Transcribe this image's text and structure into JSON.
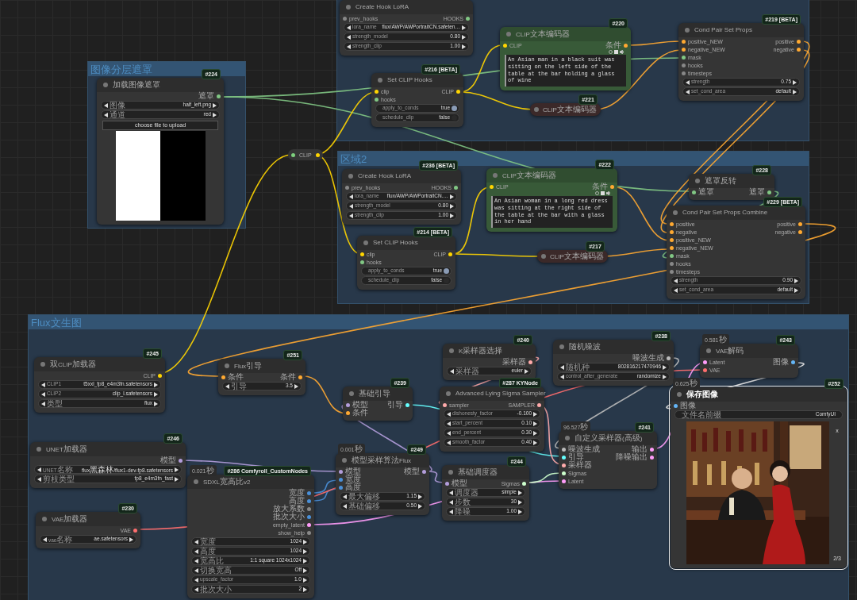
{
  "groups": [
    {
      "kind": "titled",
      "title": "图像分层遮罩"
    },
    {
      "kind": "frame"
    },
    {
      "kind": "titled",
      "title": "区域2"
    },
    {
      "kind": "titled",
      "title": "Flux文生图"
    }
  ],
  "nodes": [
    {
      "kind": "node",
      "badge": "#224",
      "title": "加载图像遮罩",
      "color": "#353535",
      "selected": false,
      "outputs": [
        {
          "label": "遮罩",
          "color": "#81c784"
        }
      ],
      "widgets": [
        {
          "kind": "combo",
          "label": "图像",
          "value": "half_left.png"
        },
        {
          "kind": "combo",
          "label": "通道",
          "value": "red"
        },
        {
          "kind": "button",
          "label": "choose file to upload"
        },
        {
          "kind": "mask"
        }
      ]
    },
    {
      "kind": "node",
      "title": "Create Hook LoRA",
      "color": "#353535",
      "selected": false,
      "inputs": [
        {
          "label": "prev_hooks",
          "color": "#888888"
        }
      ],
      "outputs": [
        {
          "label": "HOOKS",
          "color": "#81c784"
        }
      ],
      "widgets": [
        {
          "kind": "combo",
          "label": "lora_name",
          "value": "flux/AWP/AWPortraitCN.safeten…"
        },
        {
          "kind": "combo",
          "label": "strength_model",
          "value": "0.80"
        },
        {
          "kind": "combo",
          "label": "strength_clip",
          "value": "1.00"
        }
      ]
    },
    {
      "kind": "node",
      "badge": "#216 [BETA]",
      "title": "Set CLIP Hooks",
      "color": "#353535",
      "selected": false,
      "inputs": [
        {
          "label": "clip",
          "color": "#ffd500"
        },
        {
          "label": "hooks",
          "color": "#81c784"
        }
      ],
      "outputs": [
        {
          "label": "CLIP",
          "color": "#ffd500"
        }
      ],
      "widgets": [
        {
          "kind": "toggle",
          "label": "apply_to_conds",
          "value": "true",
          "on": true
        },
        {
          "kind": "toggle",
          "label": "schedule_clip",
          "value": "false",
          "on": false
        }
      ]
    },
    {
      "kind": "node",
      "badge": "#220",
      "title": "CLIP文本编码器",
      "color": "#385a38",
      "selected": false,
      "inputs": [
        {
          "label": "CLIP",
          "color": "#ffd500"
        }
      ],
      "outputs": [
        {
          "label": "条件",
          "color": "#ffa931"
        }
      ],
      "widgets": [
        {
          "kind": "textarea",
          "value": "An Asian man in a black suit was sitting on the left side of the table at the bar holding a glass of wine"
        }
      ]
    },
    {
      "kind": "collapsed",
      "badge": "#221",
      "title": "CLIP文本编码器",
      "color": "#3b2929",
      "selected": false
    },
    {
      "kind": "node",
      "badge": "#219 [BETA]",
      "title": "Cond Pair Set Props",
      "color": "#353535",
      "selected": false,
      "inputs": [
        {
          "label": "positive_NEW",
          "color": "#ffa931"
        },
        {
          "label": "negative_NEW",
          "color": "#ffa931"
        },
        {
          "label": "mask",
          "color": "#81c784"
        },
        {
          "label": "hooks",
          "color": "#888888"
        },
        {
          "label": "timesteps",
          "color": "#888888"
        }
      ],
      "outputs": [
        {
          "label": "positive",
          "color": "#ffa931"
        },
        {
          "label": "negative",
          "color": "#ffa931"
        }
      ],
      "widgets": [
        {
          "kind": "combo",
          "label": "strength",
          "value": "0.75"
        },
        {
          "kind": "combo",
          "label": "set_cond_area",
          "value": "default"
        }
      ]
    },
    {
      "kind": "reroute",
      "title": "CLIP",
      "color": "#353535",
      "selected": false,
      "inputs": [
        {
          "color": "#7ed07e"
        }
      ],
      "outputs": [
        {
          "color": "#ffd500"
        }
      ]
    },
    {
      "kind": "node",
      "badge": "#236 [BETA]",
      "title": "Create Hook LoRA",
      "color": "#353535",
      "selected": false,
      "inputs": [
        {
          "label": "prev_hooks",
          "color": "#888888"
        }
      ],
      "outputs": [
        {
          "label": "HOOKS",
          "color": "#81c784"
        }
      ],
      "widgets": [
        {
          "kind": "combo",
          "label": "lora_name",
          "value": "flux/AWP/AWPortraitCN.…"
        },
        {
          "kind": "combo",
          "label": "strength_model",
          "value": "0.80"
        },
        {
          "kind": "combo",
          "label": "strength_clip",
          "value": "1.00"
        }
      ]
    },
    {
      "kind": "node",
      "badge": "#214 [BETA]",
      "title": "Set CLIP Hooks",
      "color": "#353535",
      "selected": false,
      "inputs": [
        {
          "label": "clip",
          "color": "#ffd500"
        },
        {
          "label": "hooks",
          "color": "#81c784"
        }
      ],
      "outputs": [
        {
          "label": "CLIP",
          "color": "#ffd500"
        }
      ],
      "widgets": [
        {
          "kind": "toggle",
          "label": "apply_to_conds",
          "value": "true",
          "on": true
        },
        {
          "kind": "toggle",
          "label": "schedule_clip",
          "value": "false",
          "on": false
        }
      ]
    },
    {
      "kind": "node",
      "badge": "#222",
      "title": "CLIP文本编码器",
      "color": "#385a38",
      "selected": false,
      "inputs": [
        {
          "label": "CLIP",
          "color": "#ffd500"
        }
      ],
      "outputs": [
        {
          "label": "条件",
          "color": "#ffa931"
        }
      ],
      "widgets": [
        {
          "kind": "textarea",
          "value": "An Asian woman in a long red dress was sitting at the right side of the table at the bar with a glass in her hand"
        }
      ]
    },
    {
      "kind": "collapsed",
      "badge": "#217",
      "title": "CLIP文本编码器",
      "color": "#3b2929",
      "selected": false
    },
    {
      "kind": "node",
      "badge": "#228",
      "title": "遮罩反转",
      "color": "#353535",
      "selected": false,
      "inputs": [
        {
          "label": "遮罩",
          "color": "#81c784"
        }
      ],
      "outputs": [
        {
          "label": "遮罩",
          "color": "#81c784"
        }
      ]
    },
    {
      "kind": "node",
      "badge": "#229 [BETA]",
      "title": "Cond Pair Set Props Combine",
      "color": "#353535",
      "selected": false,
      "inputs": [
        {
          "label": "positive",
          "color": "#ffa931"
        },
        {
          "label": "negative",
          "color": "#ffa931"
        },
        {
          "label": "positive_NEW",
          "color": "#ffa931"
        },
        {
          "label": "negative_NEW",
          "color": "#ffa931"
        },
        {
          "label": "mask",
          "color": "#81c784"
        },
        {
          "label": "hooks",
          "color": "#888888"
        },
        {
          "label": "timesteps",
          "color": "#888888"
        }
      ],
      "outputs": [
        {
          "label": "positive",
          "color": "#ffa931"
        },
        {
          "label": "negative",
          "color": "#ffa931"
        }
      ],
      "widgets": [
        {
          "kind": "combo",
          "label": "strength",
          "value": "0.90"
        },
        {
          "kind": "combo",
          "label": "set_cond_area",
          "value": "default"
        }
      ]
    },
    {
      "kind": "node",
      "badge": "#245",
      "title": "双CLIP加载器",
      "color": "#353535",
      "selected": false,
      "outputs": [
        {
          "label": "CLIP",
          "color": "#ffd500"
        }
      ],
      "widgets": [
        {
          "kind": "combo",
          "label": "CLIP1",
          "value": "t5xxl_fp8_e4m3fn.safetensors"
        },
        {
          "kind": "combo",
          "label": "CLIP2",
          "value": "clip_l.safetensors"
        },
        {
          "kind": "combo",
          "label": "类型",
          "value": "flux"
        }
      ]
    },
    {
      "kind": "node",
      "badge": "#251",
      "title": "Flux引导",
      "color": "#353535",
      "selected": false,
      "inputs": [
        {
          "label": "条件",
          "color": "#ffa931"
        }
      ],
      "outputs": [
        {
          "label": "条件",
          "color": "#ffa931"
        }
      ],
      "widgets": [
        {
          "kind": "combo",
          "label": "引导",
          "value": "3.5"
        }
      ]
    },
    {
      "kind": "node",
      "badge": "#239",
      "title": "基础引导",
      "color": "#353535",
      "selected": false,
      "inputs": [
        {
          "label": "模型",
          "color": "#b39ddb"
        },
        {
          "label": "条件",
          "color": "#ffa931"
        }
      ],
      "outputs": [
        {
          "label": "引导",
          "color": "#66ffff"
        }
      ]
    },
    {
      "kind": "node",
      "badge": "#246",
      "title": "UNET加载器",
      "color": "#353535",
      "selected": false,
      "outputs": [
        {
          "label": "模型",
          "color": "#b39ddb"
        }
      ],
      "widgets": [
        {
          "kind": "combo",
          "label": "UNET名称",
          "value": "flux黑森林/flux1-dev-fp8.safetensors"
        },
        {
          "kind": "combo",
          "label": "剪枝类型",
          "value": "fp8_e4m3fn_fast"
        }
      ]
    },
    {
      "kind": "node",
      "badge": "#249",
      "timing": "0.001秒",
      "title": "模型采样算法Flux",
      "color": "#353535",
      "selected": false,
      "inputs": [
        {
          "label": "模型",
          "color": "#b39ddb"
        },
        {
          "label": "宽度",
          "color": "#4a90d9"
        },
        {
          "label": "高度",
          "color": "#4a90d9"
        }
      ],
      "outputs": [
        {
          "label": "模型",
          "color": "#b39ddb"
        }
      ],
      "widgets": [
        {
          "kind": "combo",
          "label": "最大偏移",
          "value": "1.15"
        },
        {
          "kind": "combo",
          "label": "基础偏移",
          "value": "0.50"
        }
      ]
    },
    {
      "kind": "node",
      "badge": "#286 Comfyroll_CustomNodes",
      "timing": "0.021秒",
      "title": "SDXL宽高比v2",
      "color": "#353535",
      "selected": false,
      "outputs": [
        {
          "label": "宽度",
          "color": "#4a90d9"
        },
        {
          "label": "高度",
          "color": "#4a90d9"
        },
        {
          "label": "放大系数",
          "color": "#888888"
        },
        {
          "label": "批次大小",
          "color": "#4a90d9"
        },
        {
          "label": "empty_latent",
          "color": "#ff9cf9"
        },
        {
          "label": "show_help",
          "color": "#888888"
        }
      ],
      "widgets": [
        {
          "kind": "combo",
          "label": "宽度",
          "value": "1024"
        },
        {
          "kind": "combo",
          "label": "高度",
          "value": "1024"
        },
        {
          "kind": "combo",
          "label": "宽高比",
          "value": "1:1 square 1024x1024"
        },
        {
          "kind": "combo",
          "label": "切换宽高",
          "value": "Off"
        },
        {
          "kind": "combo",
          "label": "upscale_factor",
          "value": "1.0"
        },
        {
          "kind": "combo",
          "label": "批次大小",
          "value": "2"
        }
      ]
    },
    {
      "kind": "node",
      "badge": "#230",
      "title": "VAE加载器",
      "color": "#353535",
      "selected": false,
      "outputs": [
        {
          "label": "VAE",
          "color": "#ff6e6e"
        }
      ],
      "widgets": [
        {
          "kind": "combo",
          "label": "vae名称",
          "value": "ae.safetensors"
        }
      ]
    },
    {
      "kind": "node",
      "badge": "#240",
      "title": "K采样器选择",
      "color": "#353535",
      "selected": false,
      "outputs": [
        {
          "label": "采样器",
          "color": "#ffaaaa"
        }
      ],
      "widgets": [
        {
          "kind": "combo",
          "label": "采样器",
          "value": "euler"
        }
      ]
    },
    {
      "kind": "node",
      "badge": "#287 KYNode",
      "title": "Advanced Lying Sigma Sampler",
      "color": "#353535",
      "selected": false,
      "inputs": [
        {
          "label": "sampler",
          "color": "#ffaaaa"
        }
      ],
      "outputs": [
        {
          "label": "SAMPLER",
          "color": "#ffaaaa"
        }
      ],
      "widgets": [
        {
          "kind": "combo",
          "label": "dishonesty_factor",
          "value": "-0.100"
        },
        {
          "kind": "combo",
          "label": "start_percent",
          "value": "0.10"
        },
        {
          "kind": "combo",
          "label": "end_percent",
          "value": "0.30"
        },
        {
          "kind": "combo",
          "label": "smooth_factor",
          "value": "0.40"
        }
      ]
    },
    {
      "kind": "node",
      "badge": "#244",
      "title": "基础调度器",
      "color": "#353535",
      "selected": false,
      "inputs": [
        {
          "label": "模型",
          "color": "#b39ddb"
        }
      ],
      "outputs": [
        {
          "label": "Sigmas",
          "color": "#cdffcd"
        }
      ],
      "widgets": [
        {
          "kind": "combo",
          "label": "调度器",
          "value": "simple"
        },
        {
          "kind": "combo",
          "label": "步数",
          "value": "30"
        },
        {
          "kind": "combo",
          "label": "降噪",
          "value": "1.00"
        }
      ]
    },
    {
      "kind": "node",
      "badge": "#238",
      "title": "随机噪波",
      "color": "#353535",
      "selected": false,
      "outputs": [
        {
          "label": "噪波生成",
          "color": "#bbbbbb"
        }
      ],
      "widgets": [
        {
          "kind": "combo",
          "label": "随机种",
          "value": "802816217470946"
        },
        {
          "kind": "combo",
          "label": "control_after_generate",
          "value": "randomize"
        }
      ]
    },
    {
      "kind": "node",
      "badge": "#241",
      "timing": "96.527秒",
      "title": "自定义采样器(高级)",
      "color": "#353535",
      "selected": false,
      "inputs": [
        {
          "label": "噪波生成",
          "color": "#bbbbbb"
        },
        {
          "label": "引导",
          "color": "#66ffff"
        },
        {
          "label": "采样器",
          "color": "#ffaaaa"
        },
        {
          "label": "Sigmas",
          "color": "#cdffcd"
        },
        {
          "label": "Latent",
          "color": "#ff9cf9"
        }
      ],
      "outputs": [
        {
          "label": "输出",
          "color": "#ff9cf9"
        },
        {
          "label": "降噪输出",
          "color": "#ff9cf9"
        }
      ]
    },
    {
      "kind": "node",
      "badge": "#243",
      "timing": "0.581秒",
      "title": "VAE解码",
      "color": "#353535",
      "selected": false,
      "inputs": [
        {
          "label": "Latent",
          "color": "#ff9cf9"
        },
        {
          "label": "VAE",
          "color": "#ff6e6e"
        }
      ],
      "outputs": [
        {
          "label": "图像",
          "color": "#64b5f6"
        }
      ]
    },
    {
      "kind": "node",
      "badge": "#252",
      "timing": "0.625秒",
      "title": "保存图像",
      "color": "#353535",
      "selected": true,
      "inputs": [
        {
          "label": "图像",
          "color": "#64b5f6"
        }
      ],
      "widgets": [
        {
          "kind": "text",
          "label": "文件名前缀",
          "value": "ComfyUI"
        },
        {
          "kind": "picture",
          "close": "x",
          "page": "2/3"
        }
      ]
    }
  ]
}
